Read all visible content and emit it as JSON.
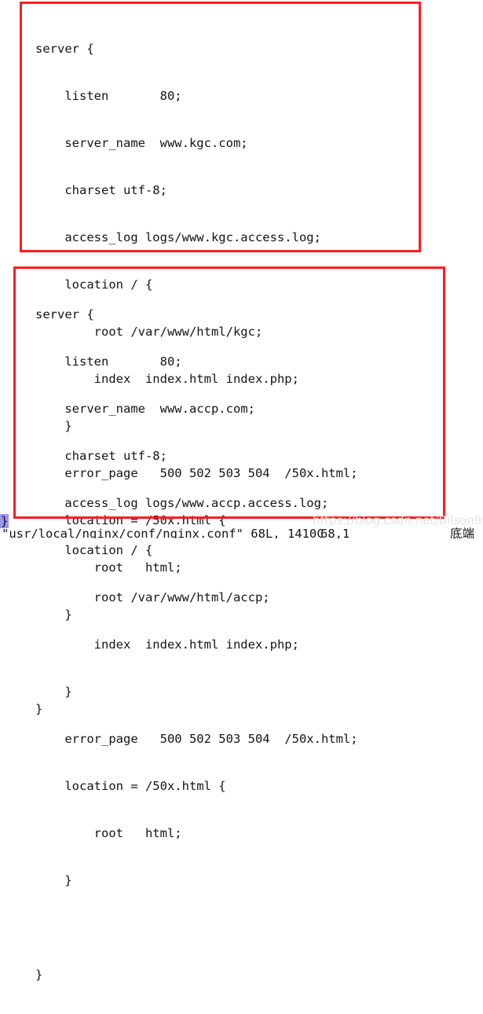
{
  "app": {
    "kind": "terminal-vim-editor",
    "background_color": "#ffffff",
    "text_color": "#141414",
    "annotation_color": "#fb1e1e",
    "cursor_highlight_color": "#9a93f0"
  },
  "annotations": {
    "box_kgc_label": "red-highlight-rectangle-kgc-server-block",
    "box_accp_label": "red-highlight-rectangle-accp-server-block"
  },
  "code_blocks": [
    {
      "id": "kgc",
      "lines": [
        "server {",
        "    listen       80;",
        "    server_name  www.kgc.com;",
        "    charset utf-8;",
        "    access_log logs/www.kgc.access.log;",
        "    location / {",
        "        root /var/www/html/kgc;",
        "        index  index.html index.php;",
        "    }",
        "    error_page   500 502 503 504  /50x.html;",
        "    location = /50x.html {",
        "        root   html;",
        "    }",
        "",
        "}"
      ]
    },
    {
      "id": "accp",
      "lines": [
        "server {",
        "    listen       80;",
        "    server_name  www.accp.com;",
        "    charset utf-8;",
        "    access_log logs/www.accp.access.log;",
        "    location / {",
        "        root /var/www/html/accp;",
        "        index  index.html index.php;",
        "    }",
        "    error_page   500 502 503 504  /50x.html;",
        "    location = /50x.html {",
        "        root   html;",
        "    }",
        "",
        "}"
      ]
    }
  ],
  "vim": {
    "cursor_char": "}",
    "status_file": "\"usr/local/nginx/conf/nginx.conf\" 68L, 1410C",
    "status_position": "68,1",
    "status_mode": "底端"
  },
  "watermark": {
    "text": "https://blog.csdn.net/Bilson99"
  }
}
